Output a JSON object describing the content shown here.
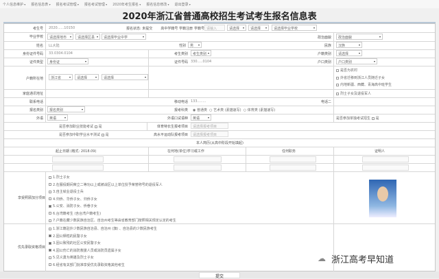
{
  "nav": [
    "个人信息维护",
    "报名信息表",
    "报名考试管理",
    "报名考试管理",
    "2020年考生报名",
    "报名信息修改",
    "退出登录"
  ],
  "title": "2020年浙江省普通高校招生考试考生报名信息表",
  "form": {
    "exam_no_label": "考生号",
    "exam_no": "2020......10150",
    "status": "报名状态: 未提交",
    "school_check_label": "高中学籍号 学籍注册",
    "school_check_value": "学籍号:",
    "school_check_ph": "请输入",
    "school_label": "毕业学校",
    "school_sel": [
      "请选择地市",
      "请选择区县",
      "请选择毕业中学"
    ],
    "school_sel2": [
      "请选择",
      "请选择",
      "请选择毕业学校"
    ],
    "politics_label": "政治面貌",
    "politics": "政治面貌",
    "name_label": "姓名",
    "name": "LL大陆",
    "gender_label": "性别",
    "gender": "男",
    "nation_label": "民族",
    "nation": "汉族",
    "id_label": "身份证件号码",
    "id": "33.0304.0104",
    "cat_label": "考生类别",
    "cat": "考生类别",
    "hk_cat_label": "户籍类别",
    "hk_cat": "请选择",
    "idtype_label": "证件类型",
    "idtype": "身份证",
    "idno_label": "证件号码",
    "idno": "330.....0104",
    "hk_type_label": "户口类别",
    "hk_type": "户口类别",
    "hk_label": "户籍所在地",
    "hk_sel": [
      "浙江省",
      "请选择",
      "请选择"
    ],
    "checks_right": [
      "是否为农村",
      "外省迁移到浙江人员随迁子女",
      "内地新疆、西藏、青海高中班学生",
      "烈士子女及退役军人"
    ],
    "addr_label": "家庭通讯地址",
    "phone_label": "联系电话",
    "mobile_label": "移动电话",
    "mobile": "133........",
    "phone2_label": "电话二",
    "reg_label": "报名类别",
    "reg": "报名类别",
    "subject_label": "报考科类",
    "subjects": [
      "普通类",
      "艺术类 (素描速写)",
      "体育类 (素描速写)"
    ],
    "lang_label": "外语",
    "lang": "英语",
    "oral_label": "外语口试语种",
    "oral": "英语",
    "single_label": "是否参加单独考试招生",
    "single_opt": "是",
    "q1_label": "是否参加职业技能考试",
    "q1_opt": "是",
    "q1b_label": "体育特长生报考项目",
    "q1b_ph": "请选择报考项目",
    "q2_label": "是否参加中职学业水平测试",
    "q2_opt": "是",
    "q2b_label": "高水平运动队报考项目",
    "q2b_ph": "请选择报考项目",
    "resume_note": "本人简历(从高中阶段开始填起)",
    "resume_headers": [
      "起止日期 (格式: 2018.09)",
      "在何地(单位)学习或工作",
      "任何职务",
      "证明人"
    ],
    "care_label": "享受照顾加分项目",
    "care_items": [
      "1.烈士子女",
      "2.在服役期间荣立二等功以上或被战区以上单位授予荣誉称号的退役军人",
      "3.自主就业退役士兵",
      "4.归侨、华侨子女、归侨子女",
      "5.公安、消防子女、侨眷子女",
      "6.台湾籍考生 (含台湾户籍考生)",
      "7.户籍在藏少数民族自治区、自治州考生等由省教育部门按照相关规定认定的考生"
    ],
    "care_checked": [
      false,
      false,
      false,
      false,
      true,
      false,
      false
    ],
    "prior_label": "优先录取资格项目",
    "prior_items": [
      "1.浙江籍驻外少数民族自治县、自治州 (旗) 、自治县的少数民族考生",
      "2.因公牺牲的民警子女",
      "3.因公致残的社区公安民警子女",
      "4.因公伤亡的消防救援人员或消防员遗属子女",
      "5.见义勇为英雄及烈士子女",
      "6.经省有关部门批准享受优先录取资格其他考生"
    ],
    "prior_checked": [
      false,
      true,
      true,
      true,
      false,
      false
    ],
    "submit": "提交",
    "watermark": "浙江高考早知道"
  }
}
